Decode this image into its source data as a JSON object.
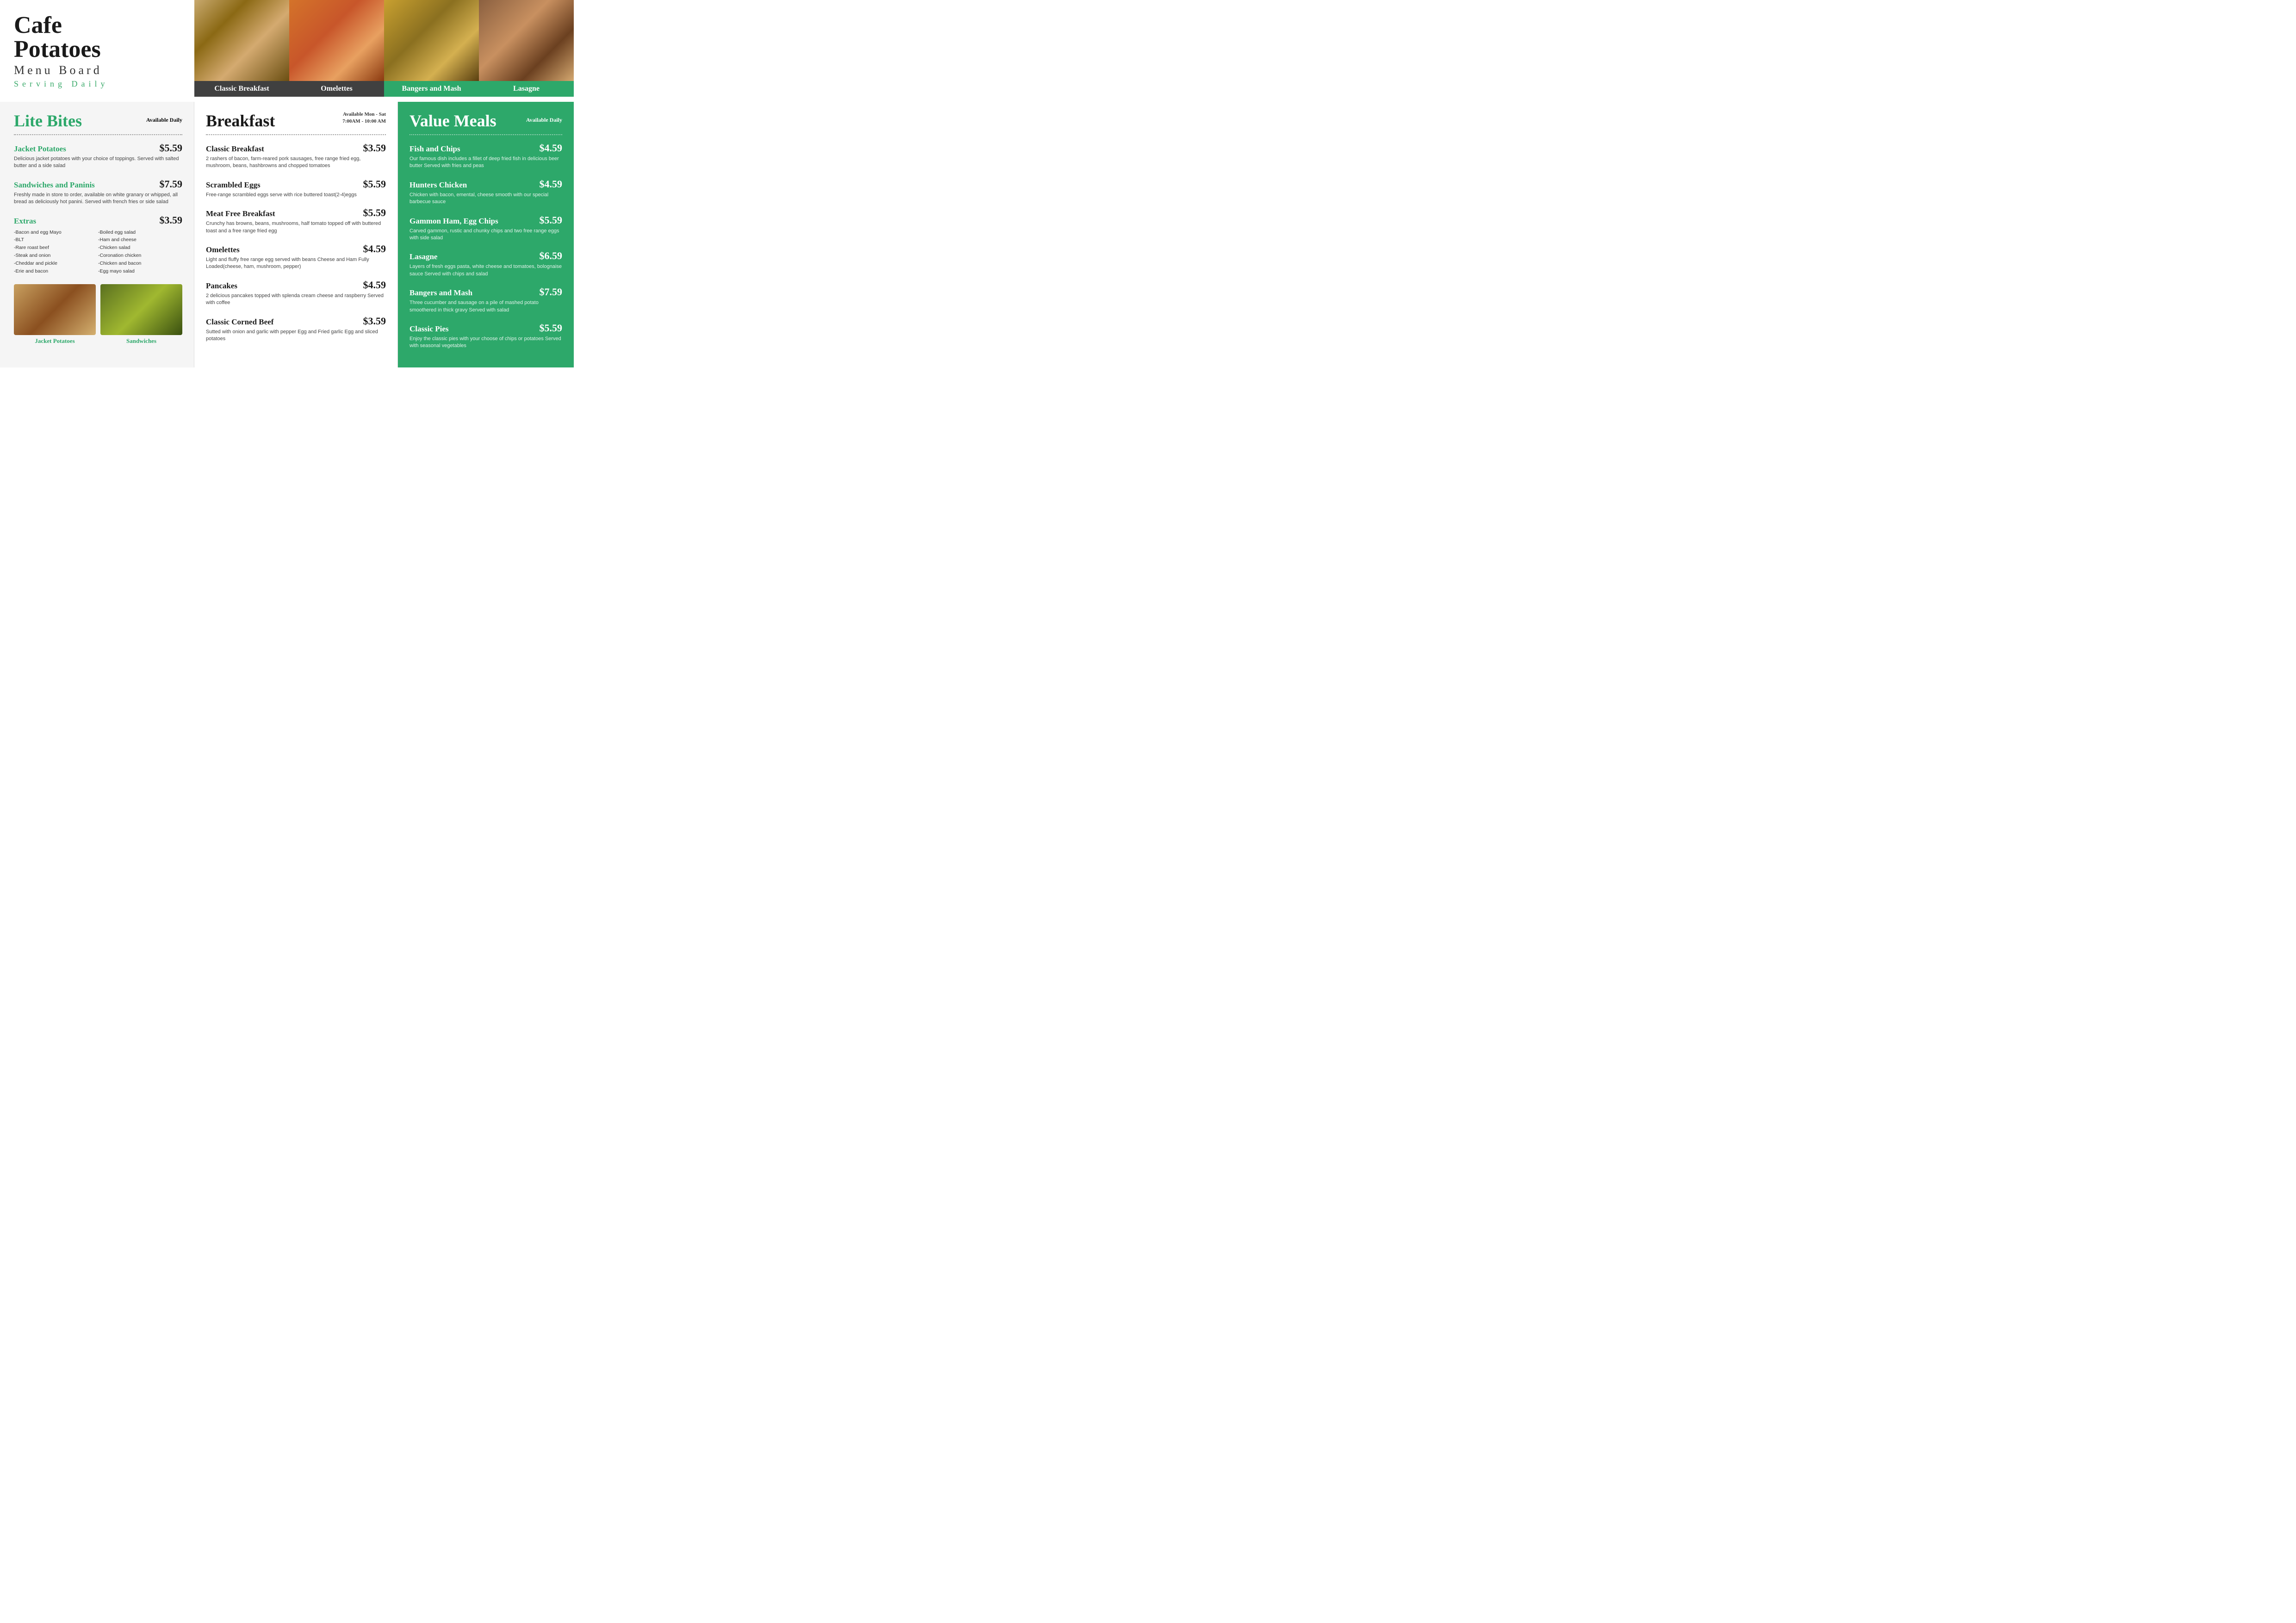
{
  "header": {
    "cafe_name": "Cafe",
    "potatoes": "Potatoes",
    "menu_board": "Menu Board",
    "serving_daily": "Serving Daily",
    "images": [
      {
        "label": "Classic Breakfast",
        "dark_bg": true
      },
      {
        "label": "Omelettes",
        "dark_bg": true
      },
      {
        "label": "Bangers and Mash",
        "dark_bg": false
      },
      {
        "label": "Lasagne",
        "dark_bg": false
      }
    ]
  },
  "lite_bites": {
    "title": "Lite Bites",
    "availability": "Available Daily",
    "items": [
      {
        "name": "Jacket Potatoes",
        "price": "$5.59",
        "desc": "Delicious jacket potatoes with your choice of toppings. Served with salted butter and a side salad"
      },
      {
        "name": "Sandwiches and Paninis",
        "price": "$7.59",
        "desc": "Freshly made in store to order, available on white granary or whipped, all bread as deliciously hot panini. Served with french fries or side salad"
      },
      {
        "name": "Extras",
        "price": "$3.59",
        "desc": ""
      }
    ],
    "extras_col1": [
      "-Bacon and egg Mayo",
      "-BLT",
      "-Rare roast beef",
      "-Steak and onion",
      "-Cheddar and pickle",
      "-Erie and bacon"
    ],
    "extras_col2": [
      "-Boiled egg salad",
      "-Ham and cheese",
      "-Chicken salad",
      "-Coronation chicken",
      "-Chicken and bacon",
      "-Egg mayo salad"
    ],
    "bottom_images": [
      {
        "label": "Jacket Potatoes"
      },
      {
        "label": "Sandwiches"
      }
    ]
  },
  "breakfast": {
    "title": "Breakfast",
    "avail_line1": "Available Mon - Sat",
    "avail_line2": "7:00AM - 10:00 AM",
    "items": [
      {
        "name": "Classic Breakfast",
        "price": "$3.59",
        "desc": "2 rashers of bacon, farm-reared pork sausages, free range fried egg, mushroom, beans, hashbrowns and chopped tomatoes"
      },
      {
        "name": "Scrambled Eggs",
        "price": "$5.59",
        "desc": "Free-range scrambled eggs serve with rice buttered toast(2-4)eggs"
      },
      {
        "name": "Meat Free Breakfast",
        "price": "$5.59",
        "desc": "Crunchy has browns, beans, mushrooms, half tomato topped off with buttered toast and a free range fried egg"
      },
      {
        "name": "Omelettes",
        "price": "$4.59",
        "desc": "Light and fluffy free range egg served with beans Cheese and Ham\nFully Loaded(cheese, ham, mushroom, pepper)"
      },
      {
        "name": "Pancakes",
        "price": "$4.59",
        "desc": "2 delicious pancakes topped with splenda cream cheese and raspberry\nServed with coffee"
      },
      {
        "name": "Classic Corned Beef",
        "price": "$3.59",
        "desc": "Sutted with onion and garlic with pepper\nEgg and Fried garlic\nEgg and sliced potatoes"
      }
    ]
  },
  "value_meals": {
    "title": "Value Meals",
    "availability": "Available Daily",
    "items": [
      {
        "name": "Fish and Chips",
        "price": "$4.59",
        "desc": "Our famous dish includes a fillet of deep fried fish in delicious beer butter\nServed with fries and peas"
      },
      {
        "name": "Hunters Chicken",
        "price": "$4.59",
        "desc": "Chicken with bacon, emental, cheese smooth with our special barbecue sauce"
      },
      {
        "name": "Gammon Ham, Egg Chips",
        "price": "$5.59",
        "desc": "Carved gammon, rustic and chunky chips and two free range eggs\nwith side salad"
      },
      {
        "name": "Lasagne",
        "price": "$6.59",
        "desc": "Layers of fresh eggs pasta, white cheese and tomatoes, bolognaise sauce\nServed with chips and salad"
      },
      {
        "name": "Bangers and Mash",
        "price": "$7.59",
        "desc": "Three cucumber and sausage on a pile of mashed potato smoothered in thick gravy\nServed with salad"
      },
      {
        "name": "Classic Pies",
        "price": "$5.59",
        "desc": "Enjoy the classic pies with your choose of chips or potatoes\nServed with seasonal vegetables"
      }
    ]
  }
}
